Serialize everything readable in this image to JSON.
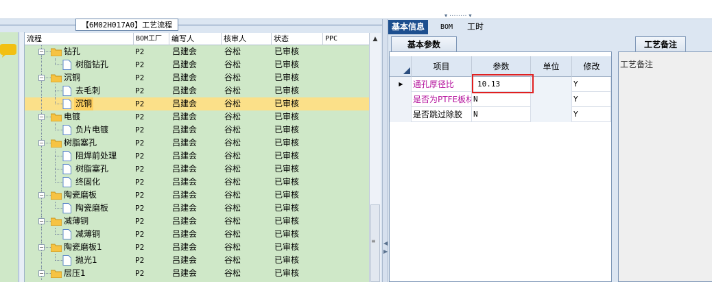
{
  "flow_panel": {
    "title": "【6M02H017A0】工艺流程",
    "columns": [
      "流程",
      "BOM工厂",
      "编写人",
      "核审人",
      "状态",
      "PPC"
    ],
    "rows": [
      {
        "level": 0,
        "type": "folder",
        "name": "钻孔",
        "bom": "P2",
        "writer": "吕建会",
        "reviewer": "谷松",
        "status": "已审核"
      },
      {
        "level": 1,
        "type": "doc",
        "name": "树脂钻孔",
        "bom": "P2",
        "writer": "吕建会",
        "reviewer": "谷松",
        "status": "已审核"
      },
      {
        "level": 0,
        "type": "folder",
        "name": "沉铜",
        "bom": "P2",
        "writer": "吕建会",
        "reviewer": "谷松",
        "status": "已审核"
      },
      {
        "level": 1,
        "type": "doc",
        "name": "去毛刺",
        "bom": "P2",
        "writer": "吕建会",
        "reviewer": "谷松",
        "status": "已审核"
      },
      {
        "level": 1,
        "type": "doc",
        "name": "沉铜",
        "bom": "P2",
        "writer": "吕建会",
        "reviewer": "谷松",
        "status": "已审核",
        "selected": true
      },
      {
        "level": 0,
        "type": "folder",
        "name": "电镀",
        "bom": "P2",
        "writer": "吕建会",
        "reviewer": "谷松",
        "status": "已审核"
      },
      {
        "level": 1,
        "type": "doc",
        "name": "负片电镀",
        "bom": "P2",
        "writer": "吕建会",
        "reviewer": "谷松",
        "status": "已审核"
      },
      {
        "level": 0,
        "type": "folder",
        "name": "树脂塞孔",
        "bom": "P2",
        "writer": "吕建会",
        "reviewer": "谷松",
        "status": "已审核"
      },
      {
        "level": 1,
        "type": "doc",
        "name": "阻焊前处理",
        "bom": "P2",
        "writer": "吕建会",
        "reviewer": "谷松",
        "status": "已审核"
      },
      {
        "level": 1,
        "type": "doc",
        "name": "树脂塞孔",
        "bom": "P2",
        "writer": "吕建会",
        "reviewer": "谷松",
        "status": "已审核"
      },
      {
        "level": 1,
        "type": "doc",
        "name": "终固化",
        "bom": "P2",
        "writer": "吕建会",
        "reviewer": "谷松",
        "status": "已审核"
      },
      {
        "level": 0,
        "type": "folder",
        "name": "陶瓷磨板",
        "bom": "P2",
        "writer": "吕建会",
        "reviewer": "谷松",
        "status": "已审核"
      },
      {
        "level": 1,
        "type": "doc",
        "name": "陶瓷磨板",
        "bom": "P2",
        "writer": "吕建会",
        "reviewer": "谷松",
        "status": "已审核"
      },
      {
        "level": 0,
        "type": "folder",
        "name": "减薄铜",
        "bom": "P2",
        "writer": "吕建会",
        "reviewer": "谷松",
        "status": "已审核"
      },
      {
        "level": 1,
        "type": "doc",
        "name": "减薄铜",
        "bom": "P2",
        "writer": "吕建会",
        "reviewer": "谷松",
        "status": "已审核"
      },
      {
        "level": 0,
        "type": "folder",
        "name": "陶瓷磨板1",
        "bom": "P2",
        "writer": "吕建会",
        "reviewer": "谷松",
        "status": "已审核"
      },
      {
        "level": 1,
        "type": "doc",
        "name": "抛光1",
        "bom": "P2",
        "writer": "吕建会",
        "reviewer": "谷松",
        "status": "已审核"
      },
      {
        "level": 0,
        "type": "folder",
        "name": "层压1",
        "bom": "P2",
        "writer": "吕建会",
        "reviewer": "谷松",
        "status": "已审核"
      }
    ]
  },
  "right_panel": {
    "tabs": [
      "基本信息",
      "BOM",
      "工时"
    ],
    "active_tab": "基本信息",
    "subtab": "基本参数",
    "remark_tab": "工艺备注",
    "remark_label": "工艺备注",
    "param_columns": [
      "项目",
      "参数",
      "单位",
      "修改"
    ],
    "params": [
      {
        "item": "通孔厚径比",
        "value": "10.13",
        "unit": "",
        "modify": "Y",
        "highlight": true
      },
      {
        "item": "是否为PTFE板材",
        "value": "N",
        "unit": "",
        "modify": "Y"
      },
      {
        "item": "是否跳过除胶",
        "value": "N",
        "unit": "",
        "modify": "Y"
      }
    ]
  },
  "colors": {
    "tree_bg": "#cfe8c8",
    "selected_row": "#fbe089",
    "active_tab": "#1d4f8f",
    "highlight_box": "#e02020",
    "item_magenta": "#b4119c"
  },
  "icons": [
    "chat-bubble-icon",
    "folder-icon",
    "document-icon",
    "expand-minus-icon",
    "scroll-up-icon",
    "row-pointer-icon"
  ]
}
